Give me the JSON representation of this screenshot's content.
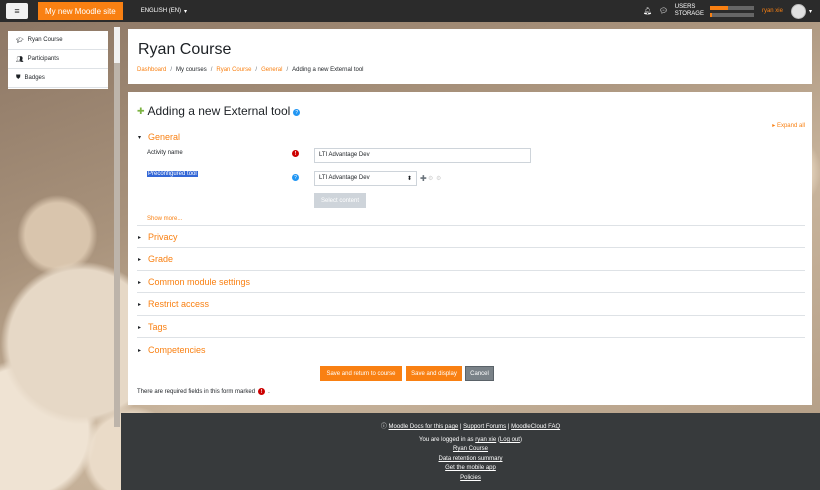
{
  "navbar": {
    "menu_icon": "hamburger-icon",
    "site_name": "My new Moodle site",
    "language": "ENGLISH (EN)",
    "usage_users": "USERS",
    "usage_storage": "STORAGE",
    "users_progress": 0.4,
    "storage_progress": 0.05,
    "user_name": "ryan xie",
    "accent": "#f98012"
  },
  "drawer": {
    "items": [
      {
        "icon": "graduation-cap-icon",
        "label": "Ryan Course"
      },
      {
        "icon": "users-icon",
        "label": "Participants"
      },
      {
        "icon": "shield-icon",
        "label": "Badges"
      }
    ]
  },
  "header": {
    "title": "Ryan Course",
    "breadcrumb": [
      "Dashboard",
      "My courses",
      "Ryan Course",
      "General",
      "Adding a new External tool"
    ]
  },
  "main": {
    "heading": "Adding a new External tool",
    "expand_all": "Expand all",
    "general_section": "General",
    "activity_name_label": "Activity name",
    "activity_name_value": "LTI Advantage Dev",
    "preconfigured_tool_label": "Preconfigured tool",
    "preconfigured_tool_value": "LTI Advantage Dev",
    "select_content": "Select content",
    "show_more": "Show more...",
    "sections": [
      "Privacy",
      "Grade",
      "Common module settings",
      "Restrict access",
      "Tags",
      "Competencies"
    ],
    "buttons": {
      "save_return": "Save and return to course",
      "save_display": "Save and display",
      "cancel": "Cancel"
    },
    "required_note": "There are required fields in this form marked",
    "required_note_end": "."
  },
  "footer": {
    "docs_link": "Moodle Docs for this page",
    "sep1": "|",
    "forums_link": "Support Forums",
    "sep2": "|",
    "faq_link": "MoodleCloud FAQ",
    "logged_in_prefix": "You are logged in as",
    "logged_in_user": "ryan xie",
    "logout": "Log out",
    "course_link": "Ryan Course",
    "data_retention": "Data retention summary",
    "mobile_app": "Get the mobile app",
    "policies": "Policies"
  }
}
